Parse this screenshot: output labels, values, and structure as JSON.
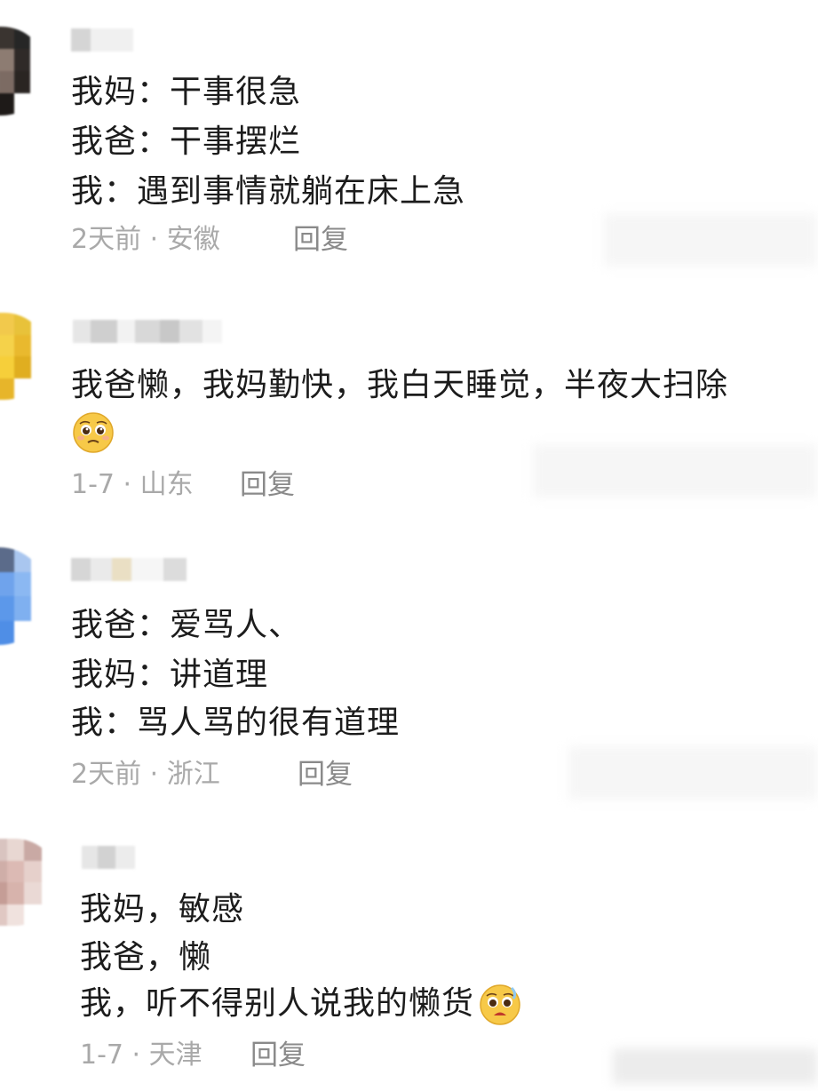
{
  "comments": [
    {
      "lines": [
        "我妈：干事很急",
        "我爸：干事摆烂",
        "我：遇到事情就躺在床上急"
      ],
      "time": "2天前",
      "sep": "·",
      "location": "安徽",
      "reply": "回复"
    },
    {
      "lines": [
        "我爸懒，我妈勤快，我白天睡觉，半夜大扫除"
      ],
      "emoji": "pleading-face-emoji",
      "time": "1-7",
      "sep": "·",
      "location": "山东",
      "reply": "回复"
    },
    {
      "lines": [
        "我爸：爱骂人、",
        "我妈：讲道理",
        "我：骂人骂的很有道理"
      ],
      "time": "2天前",
      "sep": "·",
      "location": "浙江",
      "reply": "回复"
    },
    {
      "lines": [
        "我妈，敏感",
        "我爸，懒",
        "我，听不得别人说我的懒货"
      ],
      "emoji": "pleading-face-emoji",
      "time": "1-7",
      "sep": "·",
      "location": "天津",
      "reply": "回复"
    }
  ]
}
